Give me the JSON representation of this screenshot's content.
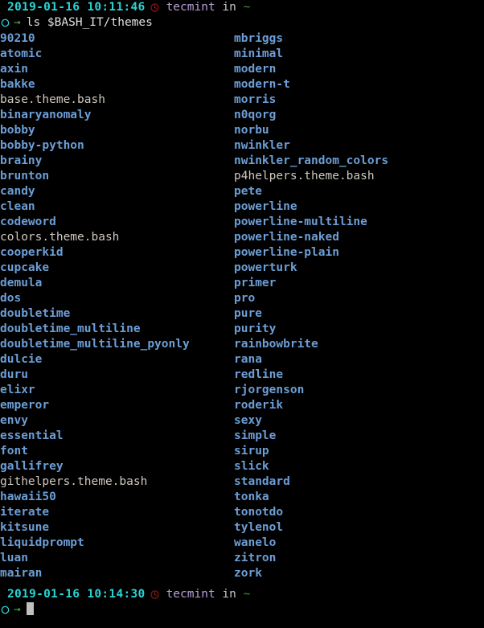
{
  "terminal": {
    "background_color": "#000000",
    "directory_color": "#6c9ed6",
    "file_color": "#cfc8bd",
    "timestamp_color": "#2ad4d4",
    "host_color": "#b9a0d8",
    "tilde_color": "#3f9c35",
    "arrow_color": "#44b544",
    "circle_color": "#2ad4d4",
    "clock_color": "#a01818"
  },
  "prompt_top": {
    "timestamp": "2019-01-16 10:11:46",
    "clock_icon": "clock-icon",
    "user": "tecmint",
    "in_word": "in",
    "path": "~",
    "circle_icon": "circle-icon",
    "arrow": "→",
    "command": "ls $BASH_IT/themes"
  },
  "prompt_bottom": {
    "timestamp": "2019-01-16 10:14:30",
    "clock_icon": "clock-icon",
    "user": "tecmint",
    "in_word": "in",
    "path": "~",
    "circle_icon": "circle-icon",
    "arrow": "→",
    "command": ""
  },
  "listing": {
    "rows": [
      {
        "col1": "90210",
        "col1_type": "dir",
        "col2": "mbriggs",
        "col2_type": "dir"
      },
      {
        "col1": "atomic",
        "col1_type": "dir",
        "col2": "minimal",
        "col2_type": "dir"
      },
      {
        "col1": "axin",
        "col1_type": "dir",
        "col2": "modern",
        "col2_type": "dir"
      },
      {
        "col1": "bakke",
        "col1_type": "dir",
        "col2": "modern-t",
        "col2_type": "dir"
      },
      {
        "col1": "base.theme.bash",
        "col1_type": "file",
        "col2": "morris",
        "col2_type": "dir"
      },
      {
        "col1": "binaryanomaly",
        "col1_type": "dir",
        "col2": "n0qorg",
        "col2_type": "dir"
      },
      {
        "col1": "bobby",
        "col1_type": "dir",
        "col2": "norbu",
        "col2_type": "dir"
      },
      {
        "col1": "bobby-python",
        "col1_type": "dir",
        "col2": "nwinkler",
        "col2_type": "dir"
      },
      {
        "col1": "brainy",
        "col1_type": "dir",
        "col2": "nwinkler_random_colors",
        "col2_type": "dir"
      },
      {
        "col1": "brunton",
        "col1_type": "dir",
        "col2": "p4helpers.theme.bash",
        "col2_type": "file"
      },
      {
        "col1": "candy",
        "col1_type": "dir",
        "col2": "pete",
        "col2_type": "dir"
      },
      {
        "col1": "clean",
        "col1_type": "dir",
        "col2": "powerline",
        "col2_type": "dir"
      },
      {
        "col1": "codeword",
        "col1_type": "dir",
        "col2": "powerline-multiline",
        "col2_type": "dir"
      },
      {
        "col1": "colors.theme.bash",
        "col1_type": "file",
        "col2": "powerline-naked",
        "col2_type": "dir"
      },
      {
        "col1": "cooperkid",
        "col1_type": "dir",
        "col2": "powerline-plain",
        "col2_type": "dir"
      },
      {
        "col1": "cupcake",
        "col1_type": "dir",
        "col2": "powerturk",
        "col2_type": "dir"
      },
      {
        "col1": "demula",
        "col1_type": "dir",
        "col2": "primer",
        "col2_type": "dir"
      },
      {
        "col1": "dos",
        "col1_type": "dir",
        "col2": "pro",
        "col2_type": "dir"
      },
      {
        "col1": "doubletime",
        "col1_type": "dir",
        "col2": "pure",
        "col2_type": "dir"
      },
      {
        "col1": "doubletime_multiline",
        "col1_type": "dir",
        "col2": "purity",
        "col2_type": "dir"
      },
      {
        "col1": "doubletime_multiline_pyonly",
        "col1_type": "dir",
        "col2": "rainbowbrite",
        "col2_type": "dir"
      },
      {
        "col1": "dulcie",
        "col1_type": "dir",
        "col2": "rana",
        "col2_type": "dir"
      },
      {
        "col1": "duru",
        "col1_type": "dir",
        "col2": "redline",
        "col2_type": "dir"
      },
      {
        "col1": "elixr",
        "col1_type": "dir",
        "col2": "rjorgenson",
        "col2_type": "dir"
      },
      {
        "col1": "emperor",
        "col1_type": "dir",
        "col2": "roderik",
        "col2_type": "dir"
      },
      {
        "col1": "envy",
        "col1_type": "dir",
        "col2": "sexy",
        "col2_type": "dir"
      },
      {
        "col1": "essential",
        "col1_type": "dir",
        "col2": "simple",
        "col2_type": "dir"
      },
      {
        "col1": "font",
        "col1_type": "dir",
        "col2": "sirup",
        "col2_type": "dir"
      },
      {
        "col1": "gallifrey",
        "col1_type": "dir",
        "col2": "slick",
        "col2_type": "dir"
      },
      {
        "col1": "githelpers.theme.bash",
        "col1_type": "file",
        "col2": "standard",
        "col2_type": "dir"
      },
      {
        "col1": "hawaii50",
        "col1_type": "dir",
        "col2": "tonka",
        "col2_type": "dir"
      },
      {
        "col1": "iterate",
        "col1_type": "dir",
        "col2": "tonotdo",
        "col2_type": "dir"
      },
      {
        "col1": "kitsune",
        "col1_type": "dir",
        "col2": "tylenol",
        "col2_type": "dir"
      },
      {
        "col1": "liquidprompt",
        "col1_type": "dir",
        "col2": "wanelo",
        "col2_type": "dir"
      },
      {
        "col1": "luan",
        "col1_type": "dir",
        "col2": "zitron",
        "col2_type": "dir"
      },
      {
        "col1": "mairan",
        "col1_type": "dir",
        "col2": "zork",
        "col2_type": "dir"
      }
    ]
  }
}
